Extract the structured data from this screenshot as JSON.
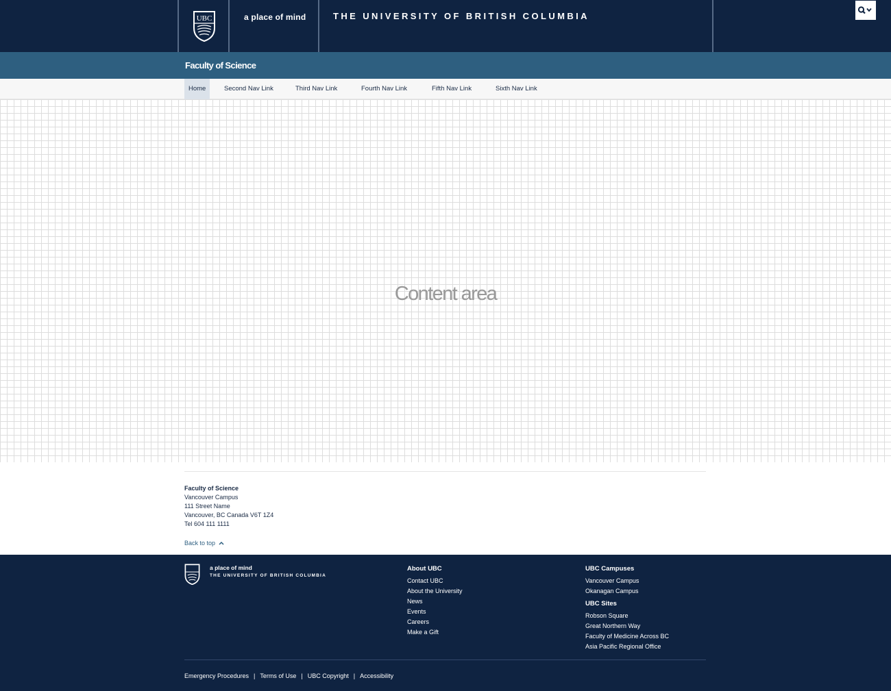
{
  "header": {
    "crest_text": "UBC",
    "tagline": "a place of mind",
    "university_name": "THE UNIVERSITY OF BRITISH COLUMBIA",
    "search_icon": "search-icon"
  },
  "unit": {
    "name": "Faculty of Science"
  },
  "nav": {
    "items": [
      {
        "label": "Home",
        "active": true
      },
      {
        "label": "Second Nav Link"
      },
      {
        "label": "Third Nav Link"
      },
      {
        "label": "Fourth Nav Link"
      },
      {
        "label": "Fifth Nav Link"
      },
      {
        "label": "Sixth Nav Link"
      }
    ]
  },
  "content": {
    "placeholder": "Content area"
  },
  "contact": {
    "title": "Faculty of Science",
    "lines": [
      "Vancouver Campus",
      "111 Street Name",
      "Vancouver, BC Canada V6T 1Z4",
      "Tel 604 111 1111"
    ],
    "back_to_top": "Back to top"
  },
  "footer": {
    "tagline": "a place of mind",
    "university_name": "THE UNIVERSITY OF BRITISH COLUMBIA",
    "about": {
      "heading": "About UBC",
      "links": [
        "Contact UBC",
        "About the University",
        "News",
        "Events",
        "Careers",
        "Make a Gift"
      ]
    },
    "campuses": {
      "heading": "UBC Campuses",
      "links": [
        "Vancouver Campus",
        "Okanagan Campus"
      ]
    },
    "sites": {
      "heading": "UBC Sites",
      "links": [
        "Robson Square",
        "Great Northern Way",
        "Faculty of Medicine Across BC",
        "Asia Pacific Regional Office"
      ]
    },
    "bottom_links": [
      "Emergency Procedures",
      "Terms of Use",
      "UBC Copyright",
      "Accessibility"
    ]
  },
  "colors": {
    "navy": "#0f2341",
    "unit_blue": "#2e5f80",
    "nav_active": "#dbe2ea"
  }
}
